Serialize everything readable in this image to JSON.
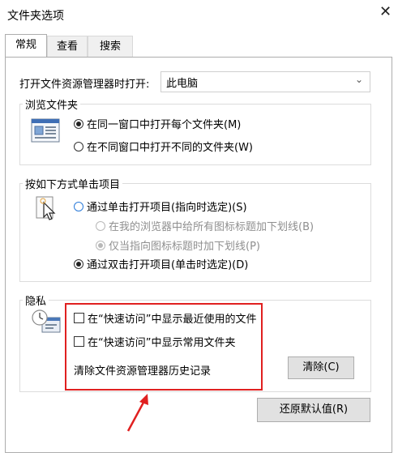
{
  "window": {
    "title": "文件夹选项"
  },
  "tabs": [
    "常规",
    "查看",
    "搜索"
  ],
  "open_explorer": {
    "label": "打开文件资源管理器时打开:",
    "value": "此电脑"
  },
  "browse_folders": {
    "title": "浏览文件夹",
    "options": [
      "在同一窗口中打开每个文件夹(M)",
      "在不同窗口中打开不同的文件夹(W)"
    ],
    "selected": 0
  },
  "click_items": {
    "title": "按如下方式单击项目",
    "single_click": "通过单击打开项目(指向时选定)(S)",
    "underline_always": "在我的浏览器中给所有图标标题加下划线(B)",
    "underline_point": "仅当指向图标标题时加下划线(P)",
    "double_click": "通过双击打开项目(单击时选定)(D)"
  },
  "privacy": {
    "title": "隐私",
    "recent_files": "在“快速访问”中显示最近使用的文件",
    "frequent_folders": "在“快速访问”中显示常用文件夹",
    "clear_history": "清除文件资源管理器历史记录",
    "clear_button": "清除(C)"
  },
  "restore_button": "还原默认值(R)",
  "colors": {
    "annotation": "#e02020",
    "selected_blue": "#2a7ad9"
  }
}
